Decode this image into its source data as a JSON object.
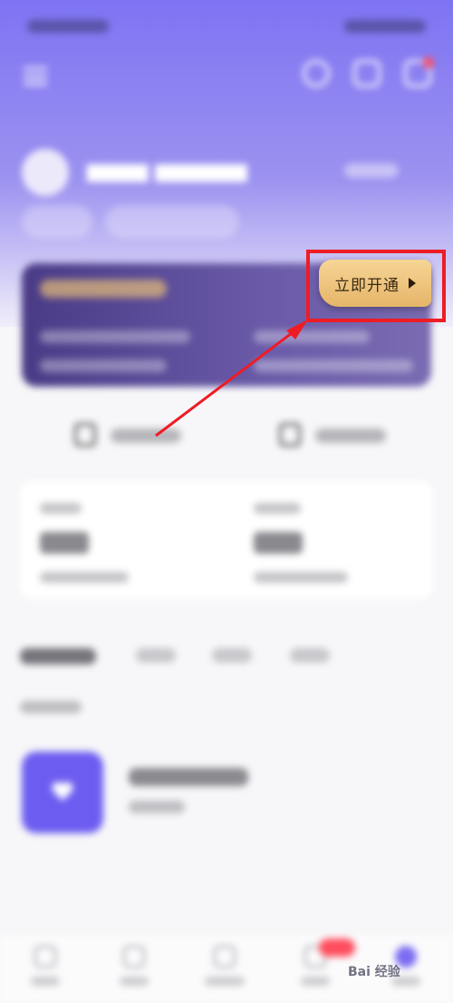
{
  "vip_card": {
    "activate_label": "立即开通",
    "activate_icon": "play-arrow-icon"
  },
  "annotation": {
    "highlight_color": "#ee1c25"
  },
  "colors": {
    "header_gradient_top": "#7e74f3",
    "vip_card": "#4a3b86",
    "button_gold": "#e6b569",
    "playlist_cover": "#6c5df0"
  },
  "watermark": "Bai 经验"
}
